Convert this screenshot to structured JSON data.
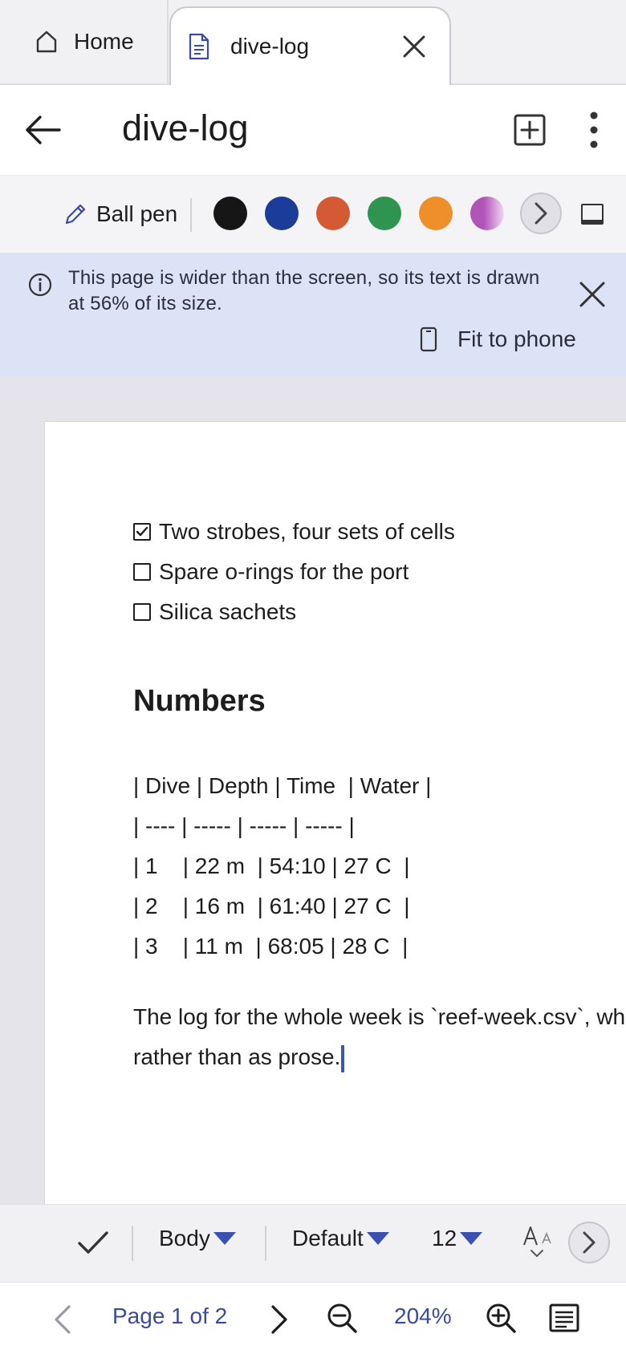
{
  "tabs": {
    "home_label": "Home",
    "doc_label": "dive-log"
  },
  "appbar": {
    "title": "dive-log"
  },
  "pen_toolbar": {
    "tool_label": "Ball pen",
    "colors": [
      "#161616",
      "#1b3d99",
      "#d35a32",
      "#2f9450",
      "#ee8f2a",
      "#b054b8"
    ]
  },
  "banner": {
    "message": "This page is wider than the screen, so its text is drawn at 56% of its size.",
    "fit_label": "Fit to phone"
  },
  "document": {
    "checklist": [
      {
        "text": "Two strobes, four sets of cells",
        "checked": true
      },
      {
        "text": "Spare o-rings for the port",
        "checked": false
      },
      {
        "text": "Silica sachets",
        "checked": false
      }
    ],
    "heading": "Numbers",
    "table_lines": [
      "| Dive | Depth | Time  | Water |",
      "| ---- | ----- | ----- | ----- |",
      "| 1    | 22 m  | 54:10 | 27 C  |",
      "| 2    | 16 m  | 61:40 | 27 C  |",
      "| 3    | 11 m  | 68:05 | 28 C  |"
    ],
    "paragraph_lines": [
      "The log for the whole week is `reef-week.csv`, wh",
      "rather than as prose."
    ]
  },
  "format_bar": {
    "style": "Body",
    "font": "Default",
    "size": "12"
  },
  "nav": {
    "page_indicator": "Page 1 of 2",
    "zoom": "204%"
  }
}
